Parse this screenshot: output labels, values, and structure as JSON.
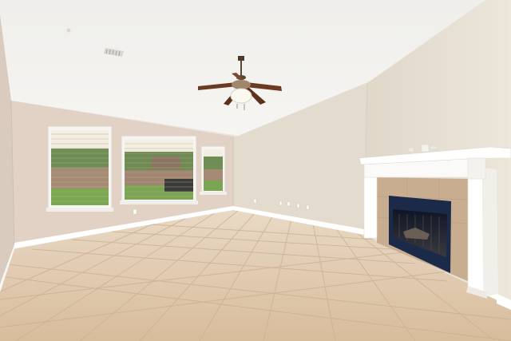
{
  "scene": {
    "subject": "empty-living-room",
    "elements": [
      "vaulted-ceiling",
      "ceiling-fan",
      "air-vent",
      "three-windows",
      "fireplace",
      "white-mantel",
      "tile-floor",
      "baseboards",
      "wall-outlets"
    ]
  },
  "colors": {
    "ceiling": "#f2f1ee",
    "wall_left": "#e2d4c7",
    "wall_right": "#e5ddd0",
    "floor": "#dcc4a8",
    "trim": "#ffffff",
    "fireplace_surround": "#c8ad90",
    "firebox": "#1c2a4a",
    "fan_blade": "#6b3a22",
    "window_grass": "#7aa552",
    "window_fence": "#a08670"
  }
}
